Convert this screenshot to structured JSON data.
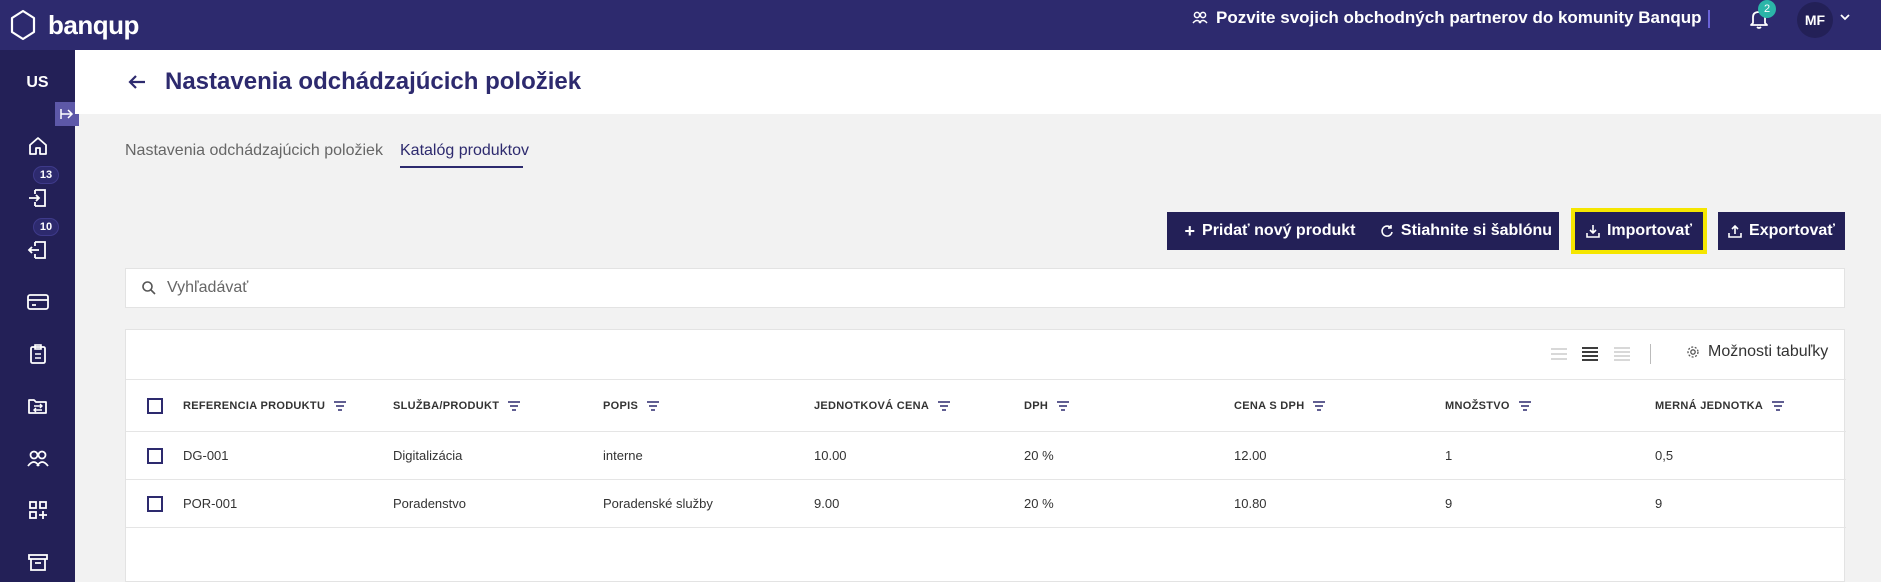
{
  "topbar": {
    "brand": "banqup",
    "invite_text": "Pozvite svojich obchodných partnerov do komunity Banqup",
    "notification_count": "2",
    "user_initials": "MF",
    "colors": {
      "topbar": "#2d2a6e",
      "sidebar": "#232057",
      "highlight": "#f5e600",
      "badge": "#2bb5a8"
    }
  },
  "sidebar": {
    "org_label": "US",
    "items": [
      {
        "icon": "home-icon"
      },
      {
        "icon": "inbox-in-icon",
        "badge": "13"
      },
      {
        "icon": "inbox-out-icon",
        "badge": "10"
      },
      {
        "icon": "card-icon"
      },
      {
        "icon": "clipboard-icon"
      },
      {
        "icon": "transfer-icon"
      },
      {
        "icon": "contacts-icon"
      },
      {
        "icon": "apps-add-icon"
      },
      {
        "icon": "archive-icon"
      }
    ]
  },
  "page": {
    "title": "Nastavenia odchádzajúcich položiek"
  },
  "tabs": [
    {
      "label": "Nastavenia odchádzajúcich položiek",
      "active": false
    },
    {
      "label": "Katalóg produktov",
      "active": true
    }
  ],
  "actions": {
    "add_product": "Pridať nový produkt",
    "download_template": "Stiahnite si šablónu",
    "import": "Importovať",
    "export": "Exportovať"
  },
  "search": {
    "placeholder": "Vyhľadávať"
  },
  "table": {
    "options_label": "Možnosti tabuľky",
    "columns": [
      "REFERENCIA PRODUKTU",
      "SLUŽBA/PRODUKT",
      "POPIS",
      "JEDNOTKOVÁ CENA",
      "DPH",
      "CENA S DPH",
      "MNOŽSTVO",
      "MERNÁ JEDNOTKA"
    ],
    "rows": [
      [
        "DG-001",
        "Digitalizácia",
        "interne",
        "10.00",
        "20 %",
        "12.00",
        "1",
        "0,5"
      ],
      [
        "POR-001",
        "Poradenstvo",
        "Poradenské služby",
        "9.00",
        "20 %",
        "10.80",
        "9",
        "9"
      ]
    ]
  }
}
